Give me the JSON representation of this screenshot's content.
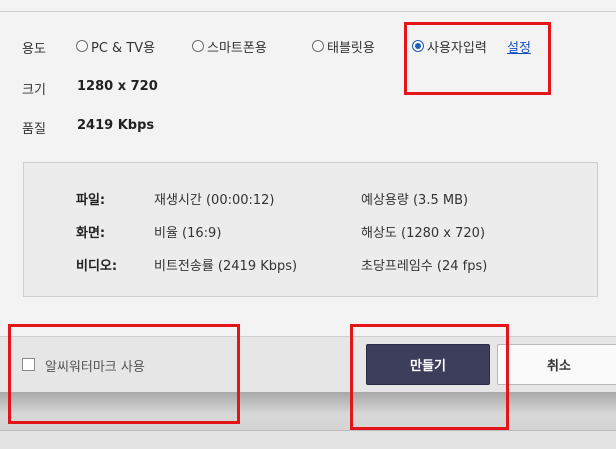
{
  "usage": {
    "label": "용도",
    "options": [
      {
        "label": "PC & TV용",
        "selected": false
      },
      {
        "label": "스마트폰용",
        "selected": false
      },
      {
        "label": "태블릿용",
        "selected": false
      },
      {
        "label": "사용자입력",
        "selected": true
      }
    ],
    "settings_link": "설정"
  },
  "size": {
    "label": "크기",
    "value": "1280 x 720"
  },
  "quality": {
    "label": "품질",
    "value": "2419 Kbps"
  },
  "info": {
    "file": {
      "key": "파일:",
      "duration": "재생시간 (00:00:12)",
      "expected_size": "예상용량 (3.5 MB)"
    },
    "screen": {
      "key": "화면:",
      "ratio": "비율 (16:9)",
      "resolution": "해상도 (1280 x 720)"
    },
    "video": {
      "key": "비디오:",
      "bitrate": "비트전송률 (2419 Kbps)",
      "fps": "초당프레임수 (24 fps)"
    }
  },
  "footer": {
    "watermark_label": "알씨워터마크 사용",
    "watermark_checked": false,
    "make_label": "만들기",
    "cancel_label": "취소"
  },
  "colors": {
    "accent": "#1f5db8",
    "primary_button": "#3d3e5c",
    "highlight": "#e4141b"
  }
}
